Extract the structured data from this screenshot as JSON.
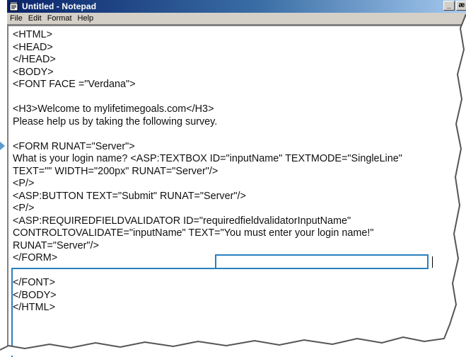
{
  "window": {
    "title": "Untitled - Notepad",
    "controls": [
      "_",
      "æ"
    ]
  },
  "menu": [
    "File",
    "Edit",
    "Format",
    "Help"
  ],
  "editor": {
    "lines": [
      "<HTML>",
      "<HEAD>",
      "</HEAD>",
      "<BODY>",
      "<FONT FACE =\"Verdana\">",
      "",
      "<H3>Welcome to mylifetimegoals.com</H3>",
      "Please help us by taking the following survey.",
      "",
      "<FORM RUNAT=\"Server\">",
      "What is your login name? <ASP:TEXTBOX ID=\"inputName\" TEXTMODE=\"SingleLine\"",
      "TEXT=\"\" WIDTH=\"200px\" RUNAT=\"Server\"/>",
      "<P/>",
      "<ASP:BUTTON TEXT=\"Submit\" RUNAT=\"Server\"/>",
      "<P/>",
      "<ASP:REQUIREDFIELDVALIDATOR ID=\"requiredfieldvalidatorInputName\"",
      "CONTROLTOVALIDATE=\"inputName\" TEXT=\"You must enter your login name!\"",
      "RUNAT=\"Server\"/>",
      "</FORM>",
      "",
      "</FONT>",
      "</BODY>",
      "</HTML>"
    ]
  },
  "colors": {
    "callout": "#2a7fbf",
    "titlebar": "#0a246a",
    "chrome": "#d4d0c8"
  },
  "icons": {
    "app": "notepad-icon",
    "minimize": "minimize-icon",
    "maximize": "maximize-icon",
    "pointer": "arrow-pointer-icon"
  }
}
